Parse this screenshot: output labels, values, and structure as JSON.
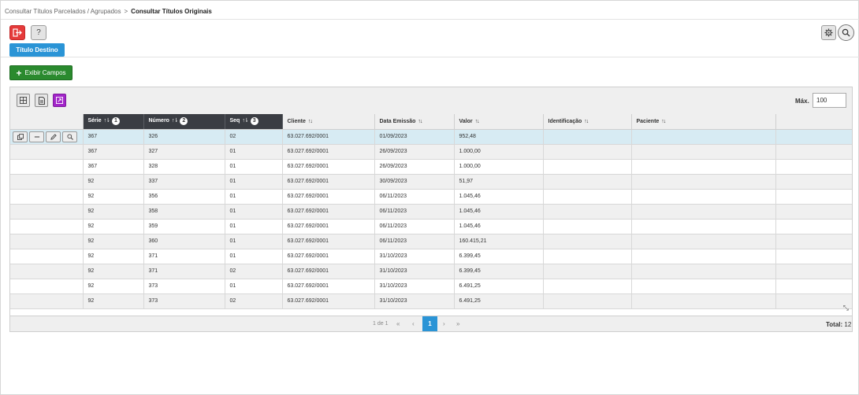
{
  "breadcrumb": {
    "parent": "Consultar Títulos Parcelados / Agrupados",
    "separator": ">",
    "current": "Consultar Títulos Originais"
  },
  "toolbar": {
    "help_label": "?",
    "titulo_destino_label": "Título Destino",
    "exibir_campos_label": "Exibir Campos",
    "exibir_campos_icon": "+"
  },
  "grid": {
    "max_label": "Máx.",
    "max_value": "100",
    "columns": [
      {
        "label": "Série",
        "sort": "↑⇂",
        "badge": "1",
        "dark": true
      },
      {
        "label": "Número",
        "sort": "↑⇂",
        "badge": "2",
        "dark": true
      },
      {
        "label": "Seq",
        "sort": "↑⇂",
        "badge": "3",
        "dark": true
      },
      {
        "label": "Cliente",
        "sort": "↑↓",
        "badge": "",
        "dark": false
      },
      {
        "label": "Data Emissão",
        "sort": "↑↓",
        "badge": "",
        "dark": false
      },
      {
        "label": "Valor",
        "sort": "↑↓",
        "badge": "",
        "dark": false
      },
      {
        "label": "Identificação",
        "sort": "↑↓",
        "badge": "",
        "dark": false
      },
      {
        "label": "Paciente",
        "sort": "↑↓",
        "badge": "",
        "dark": false
      }
    ],
    "rows": [
      [
        "367",
        "326",
        "02",
        "63.027.692/0001",
        "01/09/2023",
        "952,48",
        "",
        ""
      ],
      [
        "367",
        "327",
        "01",
        "63.027.692/0001",
        "26/09/2023",
        "1.000,00",
        "",
        ""
      ],
      [
        "367",
        "328",
        "01",
        "63.027.692/0001",
        "26/09/2023",
        "1.000,00",
        "",
        ""
      ],
      [
        "92",
        "337",
        "01",
        "63.027.692/0001",
        "30/09/2023",
        "51,97",
        "",
        ""
      ],
      [
        "92",
        "356",
        "01",
        "63.027.692/0001",
        "06/11/2023",
        "1.045,46",
        "",
        ""
      ],
      [
        "92",
        "358",
        "01",
        "63.027.692/0001",
        "06/11/2023",
        "1.045,46",
        "",
        ""
      ],
      [
        "92",
        "359",
        "01",
        "63.027.692/0001",
        "06/11/2023",
        "1.045,46",
        "",
        ""
      ],
      [
        "92",
        "360",
        "01",
        "63.027.692/0001",
        "06/11/2023",
        "160.415,21",
        "",
        ""
      ],
      [
        "92",
        "371",
        "01",
        "63.027.692/0001",
        "31/10/2023",
        "6.399,45",
        "",
        ""
      ],
      [
        "92",
        "371",
        "02",
        "63.027.692/0001",
        "31/10/2023",
        "6.399,45",
        "",
        ""
      ],
      [
        "92",
        "373",
        "01",
        "63.027.692/0001",
        "31/10/2023",
        "6.491,25",
        "",
        ""
      ],
      [
        "92",
        "373",
        "02",
        "63.027.692/0001",
        "31/10/2023",
        "6.491,25",
        "",
        ""
      ]
    ],
    "selected_row": 0
  },
  "pagination": {
    "info": "1 de 1",
    "first": "«",
    "prev": "‹",
    "current": "1",
    "next": "›",
    "last": "»",
    "total_label": "Total:",
    "total_value": "12"
  },
  "colors": {
    "exit": "#e53a3a",
    "primary": "#2a94d6",
    "success": "#2a8a2e",
    "purple": "#a225c9",
    "header_dark": "#3a3d43",
    "selected_row": "#d7ebf3"
  }
}
